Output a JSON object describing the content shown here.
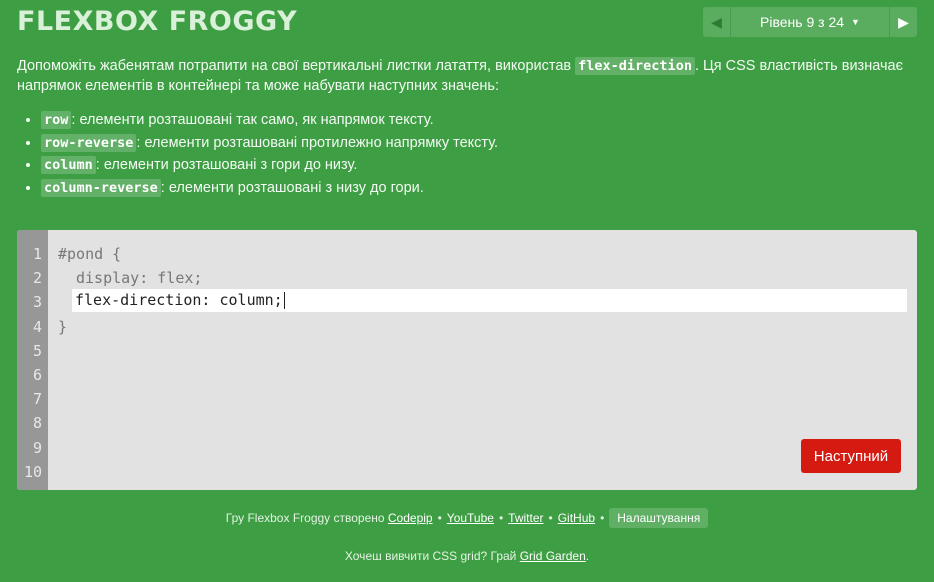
{
  "header": {
    "title": "FLEXBOX FROGGY"
  },
  "level_nav": {
    "prev_icon": "triangle-left-icon",
    "label": "Рівень 9 з 24",
    "caret": "▼",
    "next_icon": "triangle-right-icon"
  },
  "instructions": {
    "intro_before": "Допоможіть жабенятам потрапити на свої вертикальні листки латаття, використав ",
    "intro_code": "flex-direction",
    "intro_after": ". Ця CSS властивість визначає напрямок елементів в контейнері та може набувати наступних значень:",
    "values": [
      {
        "code": "row",
        "text": ": елементи розташовані так само, як напрямок тексту."
      },
      {
        "code": "row-reverse",
        "text": ": елементи розташовані протилежно напрямку тексту."
      },
      {
        "code": "column",
        "text": ": елементи розташовані з гори до низу."
      },
      {
        "code": "column-reverse",
        "text": ": елементи розташовані з низу до гори."
      }
    ]
  },
  "editor": {
    "line_numbers": [
      "1",
      "2",
      "3",
      "4",
      "5",
      "6",
      "7",
      "8",
      "9",
      "10"
    ],
    "line1": "#pond {",
    "line2": "display: flex;",
    "input_value": "flex-direction: column;",
    "line4": "}"
  },
  "next_button": {
    "label": "Наступний"
  },
  "footer": {
    "prefix": "Гру Flexbox Froggy створено ",
    "links": [
      "Codepip",
      "YouTube",
      "Twitter",
      "GitHub"
    ],
    "separator": "•",
    "settings_label": "Налаштування"
  },
  "footer2": {
    "text": "Хочеш вивчити CSS grid? Грай ",
    "link": "Grid Garden",
    "end": "."
  },
  "colors": {
    "background": "#3e9e44",
    "next_button": "#d51b11",
    "code_highlight": "#63b168"
  }
}
